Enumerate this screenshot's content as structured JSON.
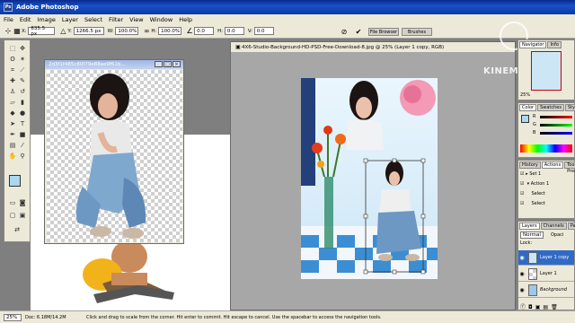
{
  "app": {
    "title": "Adobe Photoshop",
    "badge": "Ps"
  },
  "menu": [
    "File",
    "Edit",
    "Image",
    "Layer",
    "Select",
    "Filter",
    "View",
    "Window",
    "Help"
  ],
  "options": {
    "x_label": "X:",
    "x_value": "835.5 px",
    "y_label": "Y:",
    "y_value": "1266.5 px",
    "w_label": "W:",
    "w_value": "100.0%",
    "h_label": "H:",
    "h_value": "100.0%",
    "angle_value": "0.0",
    "hskew_label": "H:",
    "hskew_value": "0.0",
    "vskew_label": "V:",
    "vskew_value": "0.0"
  },
  "palette_well": {
    "file_browser": "File Browser",
    "brushes": "Brushes"
  },
  "left_doc": {
    "title": "2d3f1f485c80f79e88ae9f61b..."
  },
  "main_doc": {
    "title": "4X6-Studio-Background-HD-PSD-Free-Download-8.jpg @ 25% (Layer 1 copy, RGB)"
  },
  "watermark": "KINEMASTER",
  "navigator": {
    "title": "Navigator",
    "info_tab": "Info",
    "zoom": "25%"
  },
  "color_panel": {
    "tabs": [
      "Color",
      "Swatches",
      "Styles"
    ],
    "labels": [
      "R",
      "G",
      "B"
    ]
  },
  "actions_panel": {
    "tabs": [
      "History",
      "Actions",
      "Tool Presets"
    ],
    "rows": [
      "Set 1",
      "Action 1",
      "Select",
      "Select"
    ]
  },
  "layers_panel": {
    "tabs": [
      "Layers",
      "Channels",
      "Paths"
    ],
    "blend": "Normal",
    "opacity_label": "Opaci",
    "lock_label": "Lock:",
    "layers": [
      "Layer 1 copy",
      "Layer 1",
      "Background"
    ]
  },
  "status": {
    "zoom": "25%",
    "doc": "Doc: 6.18M/14.2M",
    "hint": "Click and drag to scale from the corner. Hit enter to commit. Hit escape to cancel. Use the spacebar to access the navigation tools."
  },
  "colors": {
    "title_blue": "#1850c8",
    "ui_gray": "#ece9d8",
    "canvas_gray": "#7f7f7f",
    "foreground": "#a9d8ef",
    "background": "#ffffff"
  }
}
